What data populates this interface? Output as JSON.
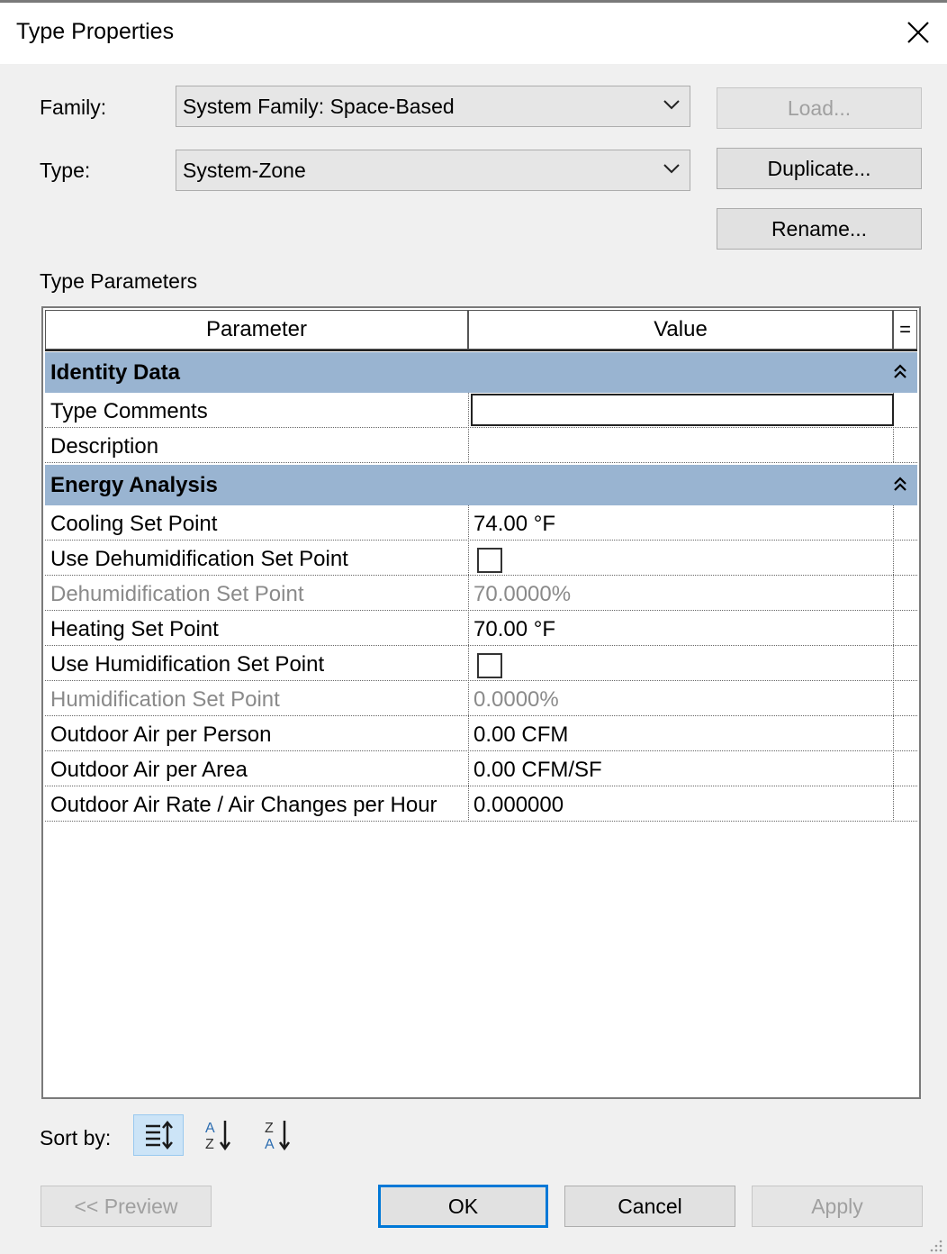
{
  "dialog": {
    "title": "Type Properties"
  },
  "family": {
    "label": "Family:",
    "value": "System Family: Space-Based"
  },
  "type": {
    "label": "Type:",
    "value": "System-Zone"
  },
  "buttons": {
    "load": "Load...",
    "duplicate": "Duplicate...",
    "rename": "Rename..."
  },
  "type_parameters_label": "Type Parameters",
  "grid": {
    "header_parameter": "Parameter",
    "header_value": "Value",
    "header_extra": "=",
    "groups": [
      {
        "name": "Identity Data",
        "rows": [
          {
            "parameter": "Type Comments",
            "value": ""
          },
          {
            "parameter": "Description",
            "value": ""
          }
        ]
      },
      {
        "name": "Energy Analysis",
        "rows": [
          {
            "parameter": "Cooling Set Point",
            "value": "74.00 °F"
          },
          {
            "parameter": "Use Dehumidification Set Point",
            "value": "",
            "checked": false
          },
          {
            "parameter": "Dehumidification Set Point",
            "value": "70.0000%",
            "disabled": true
          },
          {
            "parameter": "Heating Set Point",
            "value": "70.00 °F"
          },
          {
            "parameter": "Use Humidification Set Point",
            "value": "",
            "checked": false
          },
          {
            "parameter": "Humidification Set Point",
            "value": "0.0000%",
            "disabled": true
          },
          {
            "parameter": "Outdoor Air per Person",
            "value": "0.00 CFM"
          },
          {
            "parameter": "Outdoor Air per Area",
            "value": "0.00 CFM/SF"
          },
          {
            "parameter": "Outdoor Air Rate / Air Changes per Hour",
            "value": "0.000000"
          }
        ]
      }
    ]
  },
  "sort": {
    "label": "Sort by:"
  },
  "footer": {
    "preview": "<< Preview",
    "ok": "OK",
    "cancel": "Cancel",
    "apply": "Apply"
  }
}
